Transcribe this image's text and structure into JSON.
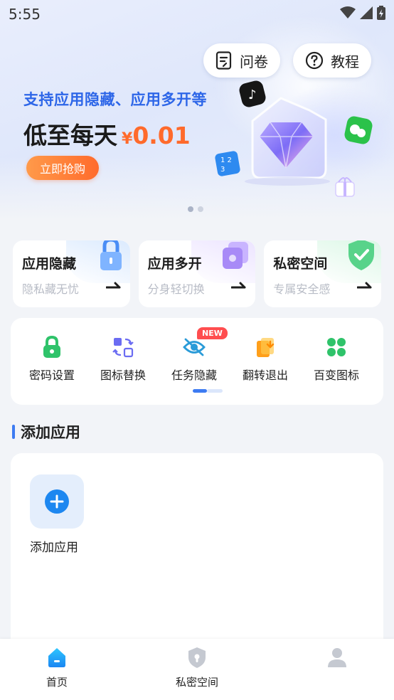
{
  "status_bar": {
    "time": "5:55"
  },
  "header": {
    "survey_label": "问卷",
    "tutorial_label": "教程"
  },
  "banner": {
    "headline": "支持应用隐藏、应用多开等",
    "price_prefix": "低至每天",
    "currency": "¥",
    "price": "0.01",
    "buy_label": "立即抢购",
    "page_count": 2,
    "active_page": 1
  },
  "features": [
    {
      "title": "应用隐藏",
      "subtitle": "隐私藏无忧",
      "icon": "lock-icon"
    },
    {
      "title": "应用多开",
      "subtitle": "分身轻切换",
      "icon": "layers-icon"
    },
    {
      "title": "私密空间",
      "subtitle": "专属安全感",
      "icon": "shield-icon"
    }
  ],
  "tools": [
    {
      "label": "密码设置",
      "icon": "padlock-icon"
    },
    {
      "label": "图标替换",
      "icon": "swap-icon"
    },
    {
      "label": "任务隐藏",
      "icon": "eye-off-icon",
      "badge": "NEW"
    },
    {
      "label": "翻转退出",
      "icon": "flip-icon"
    },
    {
      "label": "百变图标",
      "icon": "clover-icon"
    }
  ],
  "section": {
    "title": "添加应用"
  },
  "add_app": {
    "label": "添加应用"
  },
  "bottom_nav": [
    {
      "label": "首页",
      "icon": "home-icon",
      "active": true
    },
    {
      "label": "私密空间",
      "icon": "shield-icon",
      "active": false
    },
    {
      "label": "",
      "icon": "profile-icon",
      "active": false
    }
  ],
  "colors": {
    "accent": "#3d7bf2",
    "promo_blue": "#2d66e8",
    "price_orange": "#ff6a2b",
    "badge_red": "#ff4d4f"
  }
}
